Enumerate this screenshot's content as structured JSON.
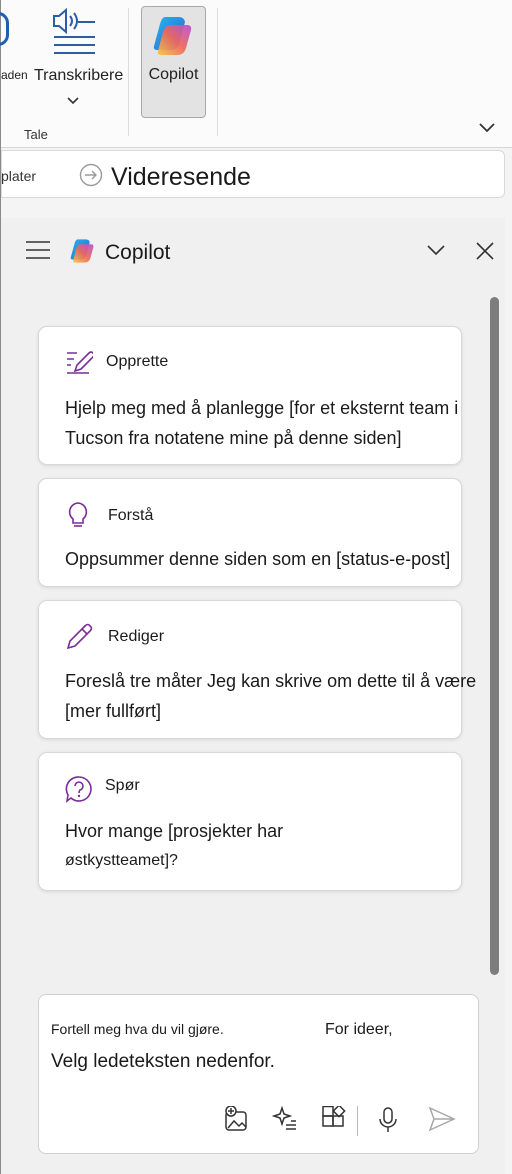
{
  "ribbon": {
    "read_label": "aden",
    "transcribe_label": "Transkribere",
    "group_label": "Tale",
    "copilot_label": "Copilot"
  },
  "forward_bar": {
    "partial_label": "plater",
    "forward_label": "Videresende"
  },
  "pane": {
    "title": "Copilot",
    "cards": [
      {
        "title": "Opprette",
        "icon": "edit-note-icon",
        "lines": [
          "Hjelp meg med å planlegge [for et eksternt team i",
          "Tucson fra notatene mine på denne siden]"
        ]
      },
      {
        "title": "Forstå",
        "icon": "lightbulb-icon",
        "lines": [
          "Oppsummer denne siden som en [status-e-post]"
        ]
      },
      {
        "title": "Rediger",
        "icon": "pencil-icon",
        "lines": [
          "Foreslå tre måter   Jeg kan skrive om dette til å være",
          "[mer fullført]"
        ]
      },
      {
        "title": "Spør",
        "icon": "question-bubble-icon",
        "lines": [
          "Hvor mange [prosjekter har",
          "østkystteamet]?"
        ]
      }
    ]
  },
  "composer": {
    "hint_a": "Fortell meg hva du vil gjøre.",
    "hint_b": "For ideer,",
    "hint_c": "Velg ledeteksten nedenfor.",
    "tools": [
      "add-image-icon",
      "prompt-sparkle-icon",
      "plugins-icon",
      "microphone-icon",
      "send-icon"
    ]
  },
  "colors": {
    "accent_purple": "#7a2e97",
    "ribbon_blue": "#1f5fb0"
  }
}
